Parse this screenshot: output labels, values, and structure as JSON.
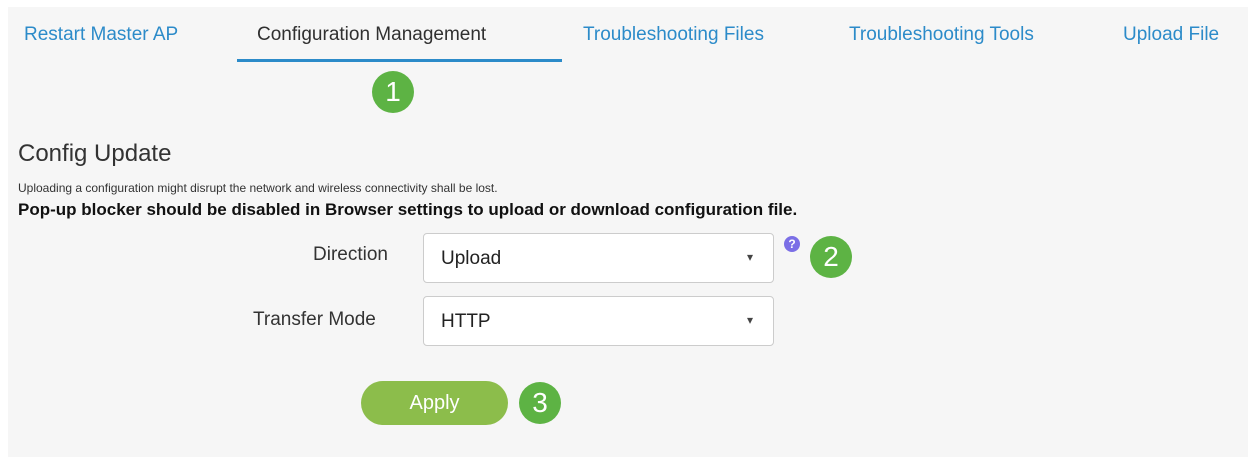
{
  "tabs": [
    {
      "label": "Restart Master AP",
      "active": false
    },
    {
      "label": "Configuration Management",
      "active": true
    },
    {
      "label": "Troubleshooting Files",
      "active": false
    },
    {
      "label": "Troubleshooting Tools",
      "active": false
    },
    {
      "label": "Upload File",
      "active": false
    }
  ],
  "step_markers": {
    "first": "1",
    "second": "2",
    "third": "3"
  },
  "config_update": {
    "title": "Config Update",
    "warning": "Uploading a configuration might disrupt the network and wireless connectivity shall be lost.",
    "note": "Pop-up blocker should be disabled in Browser settings to upload or download configuration file.",
    "direction": {
      "label": "Direction",
      "value": "Upload",
      "help_icon": "question-circle-icon",
      "help_glyph": "?"
    },
    "transfer_mode": {
      "label": "Transfer Mode",
      "value": "HTTP"
    },
    "caret_glyph": "▾",
    "apply_label": "Apply"
  },
  "colors": {
    "tab_link": "#2c8bc9",
    "tab_underline": "#2c8bc9",
    "step_marker": "#5db344",
    "apply_button": "#8cbd4b",
    "help_icon": "#7b6fe6",
    "panel_background": "#f6f6f6"
  }
}
